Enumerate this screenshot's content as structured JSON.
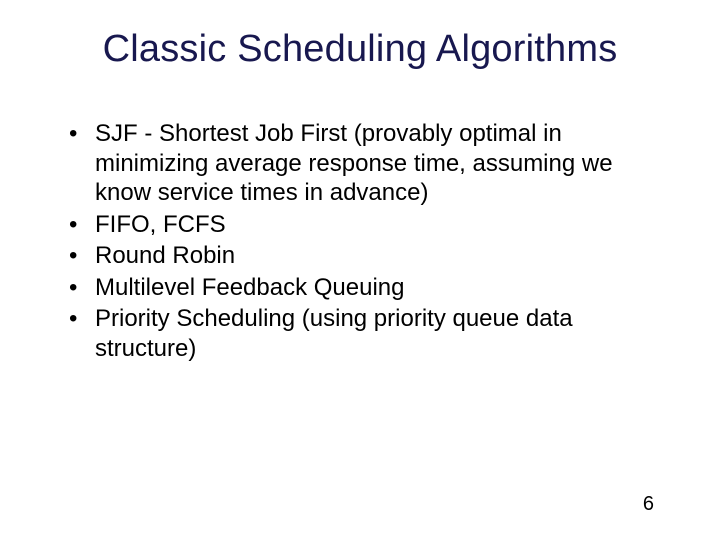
{
  "title": "Classic Scheduling Algorithms",
  "bullets": [
    "SJF - Shortest Job First (provably optimal in minimizing average response time, assuming we know service times in advance)",
    "FIFO, FCFS",
    "Round Robin",
    "Multilevel Feedback Queuing",
    "Priority Scheduling (using priority queue data structure)"
  ],
  "page_number": "6"
}
